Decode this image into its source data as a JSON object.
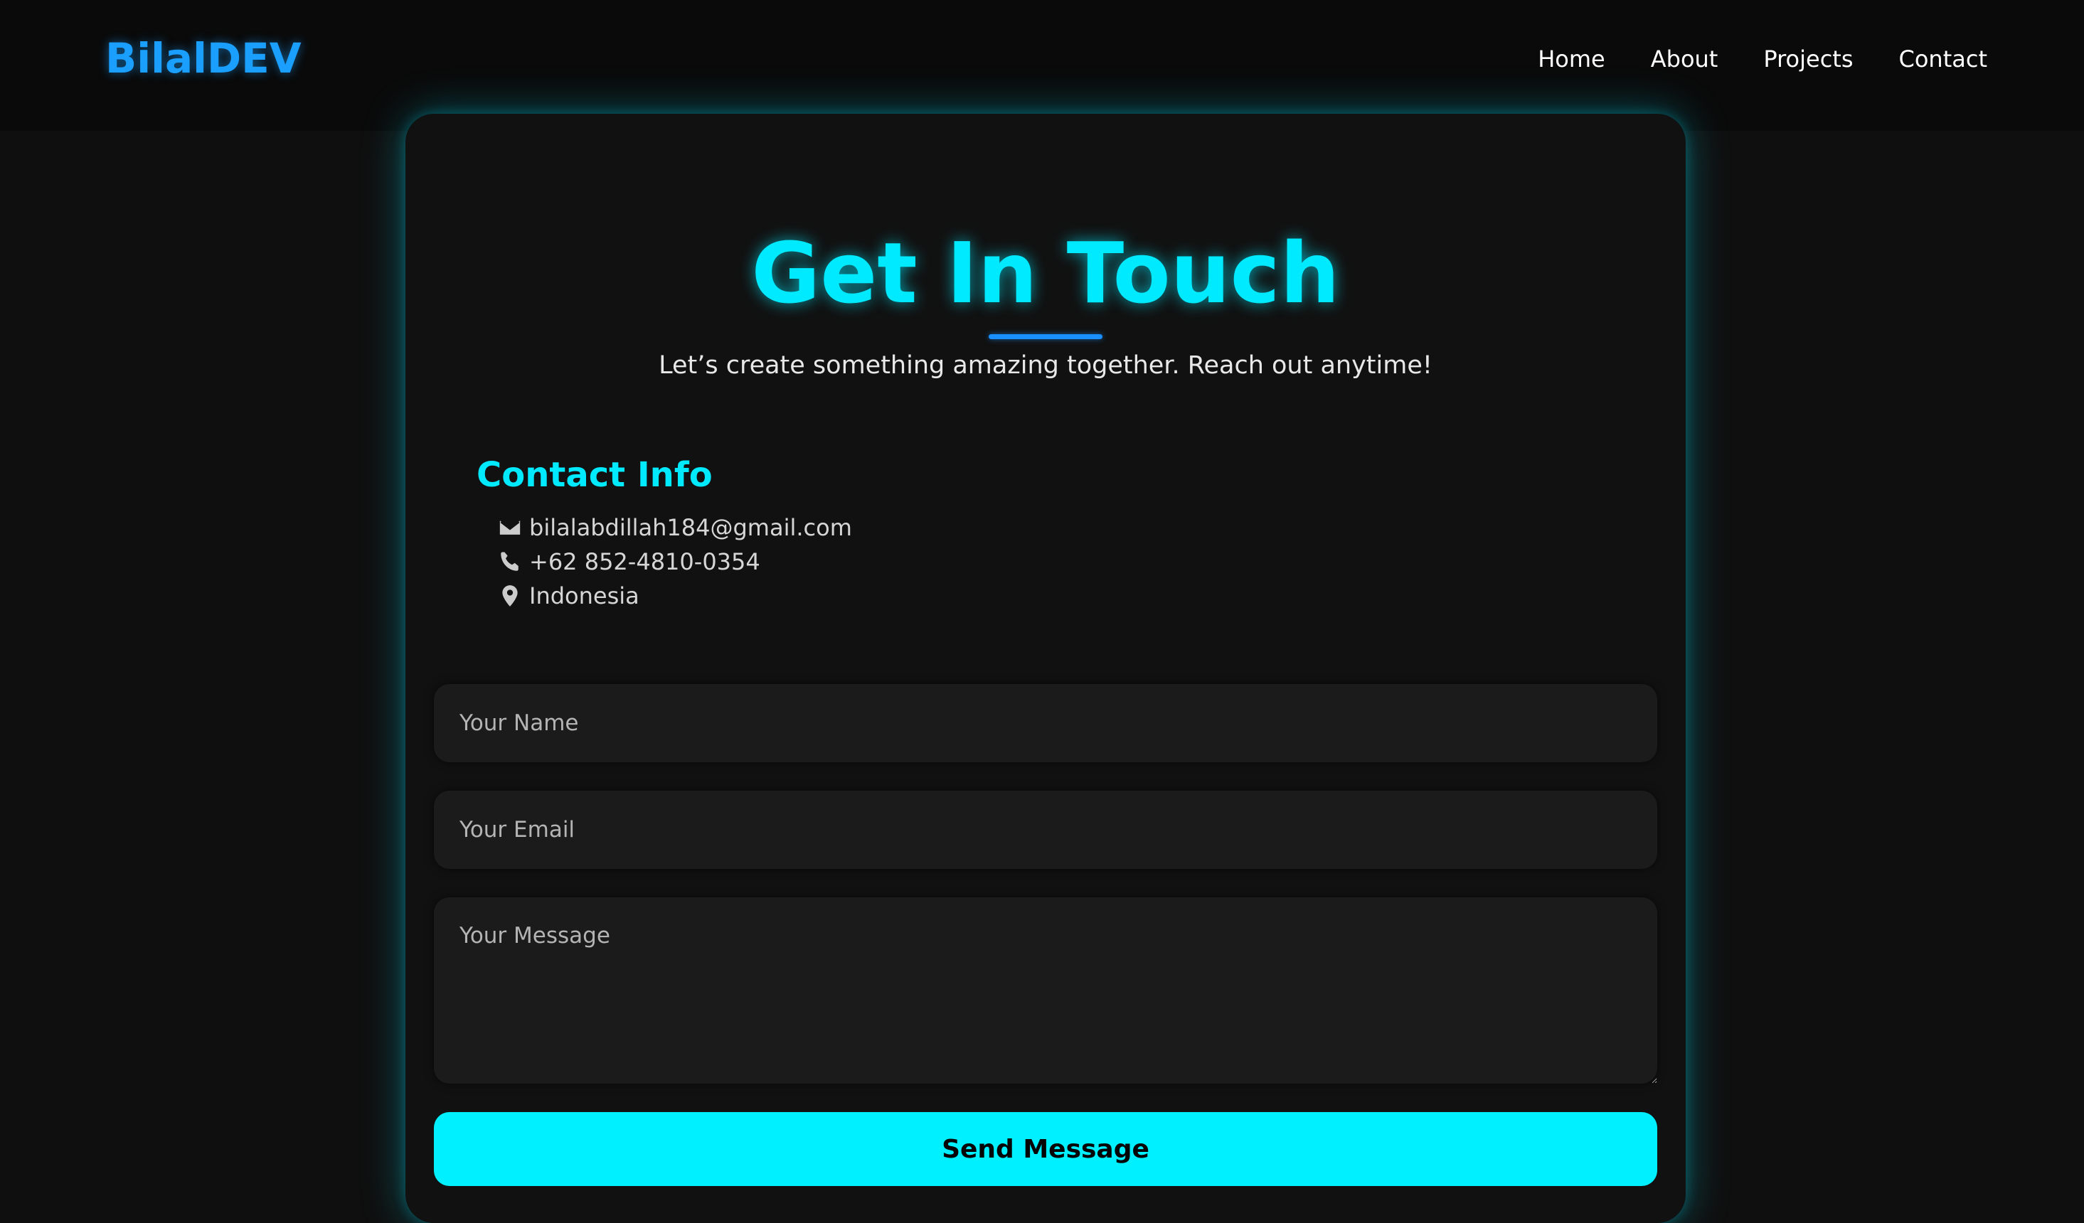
{
  "brand": {
    "logo": "BilalDEV",
    "accent": "#1a9fff",
    "cyan": "#00eaff"
  },
  "nav": {
    "items": [
      "Home",
      "About",
      "Projects",
      "Contact"
    ]
  },
  "hero": {
    "title": "Get In Touch",
    "subtitle": "Let’s create something amazing together. Reach out anytime!"
  },
  "contact_info": {
    "title": "Contact Info",
    "email": {
      "icon": "envelope-icon",
      "text": "bilalabdillah184@gmail.com"
    },
    "phone": {
      "icon": "phone-icon",
      "text": "+62 852-4810-0354"
    },
    "location": {
      "icon": "map-pin-icon",
      "text": "Indonesia"
    }
  },
  "form": {
    "name_placeholder": "Your Name",
    "email_placeholder": "Your Email",
    "message_placeholder": "Your Message",
    "submit_label": "Send Message"
  }
}
